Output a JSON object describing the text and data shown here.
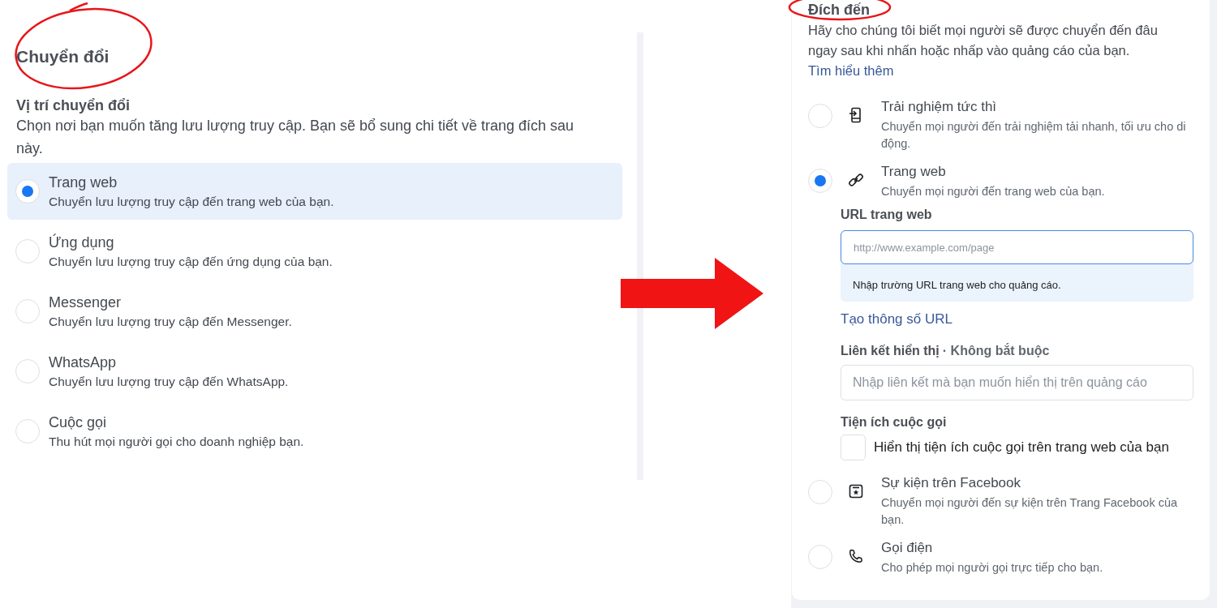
{
  "left_panel": {
    "title": "Chuyển đổi",
    "section_label": "Vị trí chuyển đổi",
    "section_description": "Chọn nơi bạn muốn tăng lưu lượng truy cập. Bạn sẽ bổ sung chi tiết về trang đích sau này.",
    "options": [
      {
        "label": "Trang web",
        "description": "Chuyển lưu lượng truy cập đến trang web của bạn.",
        "selected": true
      },
      {
        "label": "Ứng dụng",
        "description": "Chuyển lưu lượng truy cập đến ứng dụng của bạn.",
        "selected": false
      },
      {
        "label": "Messenger",
        "description": "Chuyển lưu lượng truy cập đến Messenger.",
        "selected": false
      },
      {
        "label": "WhatsApp",
        "description": "Chuyển lưu lượng truy cập đến WhatsApp.",
        "selected": false
      },
      {
        "label": "Cuộc gọi",
        "description": "Thu hút mọi người gọi cho doanh nghiệp bạn.",
        "selected": false
      }
    ]
  },
  "right_panel": {
    "title": "Đích đến",
    "description": "Hãy cho chúng tôi biết mọi người sẽ được chuyển đến đâu ngay sau khi nhấn hoặc nhấp vào quảng cáo của bạn.",
    "learn_more_link": "Tìm hiểu thêm",
    "options": [
      {
        "kind": "instant",
        "label": "Trải nghiệm tức thì",
        "description": "Chuyển mọi người đến trải nghiệm tải nhanh, tối ưu cho di động.",
        "selected": false
      },
      {
        "kind": "link",
        "label": "Trang web",
        "description": "Chuyển mọi người đến trang web của bạn.",
        "selected": true,
        "details": {
          "url_label": "URL trang web",
          "url_placeholder": "http://www.example.com/page",
          "url_hint": "Nhập trường URL trang web cho quảng cáo.",
          "url_params_link": "Tạo thông số URL",
          "display_link_label": "Liên kết hiển thị",
          "display_link_optional": "· Không bắt buộc",
          "display_link_placeholder": "Nhập liên kết mà bạn muốn hiển thị trên quảng cáo",
          "call_extension_label": "Tiện ích cuộc gọi",
          "call_extension_checkbox": "Hiển thị tiện ích cuộc gọi trên trang web của bạn",
          "call_extension_checked": false
        }
      },
      {
        "kind": "event",
        "label": "Sự kiện trên Facebook",
        "description": "Chuyển mọi người đến sự kiện trên Trang Facebook của bạn.",
        "selected": false
      },
      {
        "kind": "phone",
        "label": "Gọi điện",
        "description": "Cho phép mọi người gọi trực tiếp cho bạn.",
        "selected": false
      }
    ]
  }
}
